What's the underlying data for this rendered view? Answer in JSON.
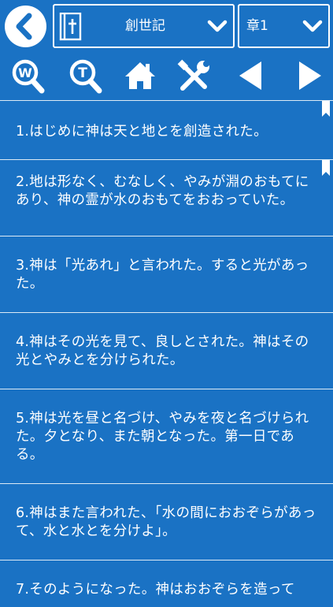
{
  "header": {
    "book": "創世記",
    "chapter": "章1"
  },
  "icons": {
    "back": "chevron-left-icon",
    "book_selector": "bible-icon",
    "dropdown": "chevron-down-icon",
    "word_search": "magnifier-w-icon",
    "text_search": "magnifier-t-icon",
    "home": "home-icon",
    "settings": "tools-icon",
    "previous": "triangle-left-icon",
    "next": "triangle-right-icon",
    "bookmark": "bookmark-ribbon-icon"
  },
  "colors": {
    "background": "#1a72c4",
    "foreground": "#ffffff"
  },
  "verses": [
    {
      "text": "1.はじめに神は天と地とを創造された。",
      "bookmarked": true
    },
    {
      "text": "2.地は形なく、むなしく、やみが淵のおもてにあり、神の霊が水のおもてをおおっていた。",
      "bookmarked": true
    },
    {
      "text": "3.神は「光あれ」と言われた。すると光があった。",
      "bookmarked": false
    },
    {
      "text": "4.神はその光を見て、良しとされた。神はその光とやみとを分けられた。",
      "bookmarked": false
    },
    {
      "text": "5.神は光を昼と名づけ、やみを夜と名づけられた。夕となり、また朝となった。第一日である。",
      "bookmarked": false
    },
    {
      "text": "6.神はまた言われた、「水の間におおぞらがあって、水と水とを分けよ」。",
      "bookmarked": false
    },
    {
      "text": "7.そのようになった。神はおおぞらを造って",
      "bookmarked": false
    }
  ]
}
